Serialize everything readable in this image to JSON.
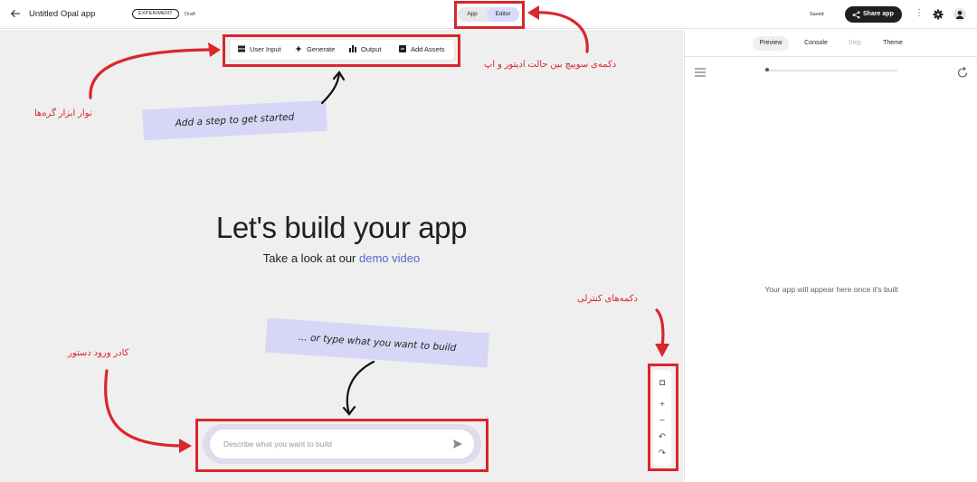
{
  "header": {
    "back_icon": "arrow-left-icon",
    "app_title": "Untitled Opal app",
    "badge": "EXPERIMENT",
    "status": "Draft",
    "mode_app": "App",
    "mode_editor": "Editor",
    "saved": "Saved",
    "share": "Share app",
    "kebab": "⋮"
  },
  "toolbar": {
    "items": [
      {
        "label": "User Input",
        "icon": "input-icon"
      },
      {
        "label": "Generate",
        "icon": "sparkle-icon"
      },
      {
        "label": "Output",
        "icon": "output-icon"
      },
      {
        "label": "Add Assets",
        "icon": "asset-icon"
      }
    ]
  },
  "canvas": {
    "note_top": "Add a step to get started",
    "hero": "Let's build your app",
    "sub_prefix": "Take a look at our ",
    "sub_link": "demo video",
    "note_bottom": "... or type what you want to build",
    "prompt_placeholder": "Describe what you want to build"
  },
  "zoom": {
    "fit": "◘",
    "plus": "+",
    "minus": "−",
    "undo": "↶",
    "redo": "↷"
  },
  "annotations": {
    "toolbar": "نوار ابزار گره‌ها",
    "mode": "دکمه‌ی سوییچ بین حالت ادیتور و اپ",
    "controls": "دکمه‌های کنترلی",
    "prompt": "کادر ورود دستور"
  },
  "panel": {
    "tabs": [
      "Preview",
      "Console",
      "Step",
      "Theme"
    ],
    "empty": "Your app will appear here once it's built"
  },
  "colors": {
    "annotation_red": "#d9262c",
    "editor_active": "#d8dbfb",
    "note_bg": "#d6d6f6",
    "link": "#5867d3"
  }
}
